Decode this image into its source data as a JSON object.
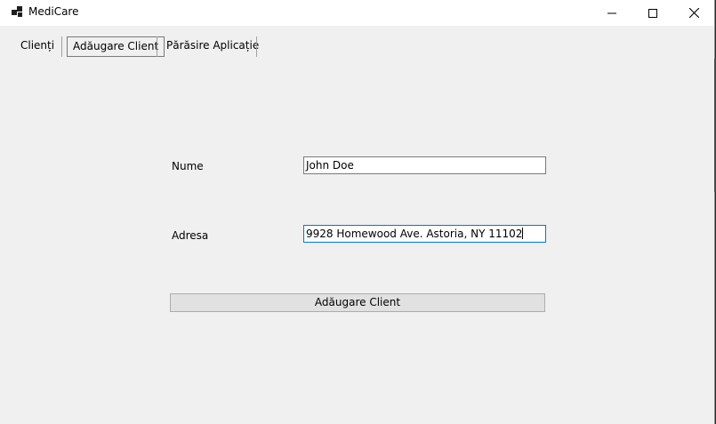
{
  "window": {
    "title": "MediCare",
    "icons": {
      "app": "app-icon",
      "minimize": "minimize-icon",
      "maximize": "maximize-icon",
      "close": "close-icon"
    }
  },
  "menu": {
    "items": [
      {
        "label": "Clienți"
      },
      {
        "label": "Adăugare Client",
        "selected": true
      },
      {
        "label": "Părăsire Aplicație"
      }
    ]
  },
  "form": {
    "nume_label": "Nume",
    "nume_value": "John Doe",
    "adresa_label": "Adresa",
    "adresa_value": "9928 Homewood Ave. Astoria, NY 11102",
    "submit_label": "Adăugare Client"
  },
  "colors": {
    "window_bg": "#f0f0f0",
    "focus_border": "#0078d7"
  }
}
